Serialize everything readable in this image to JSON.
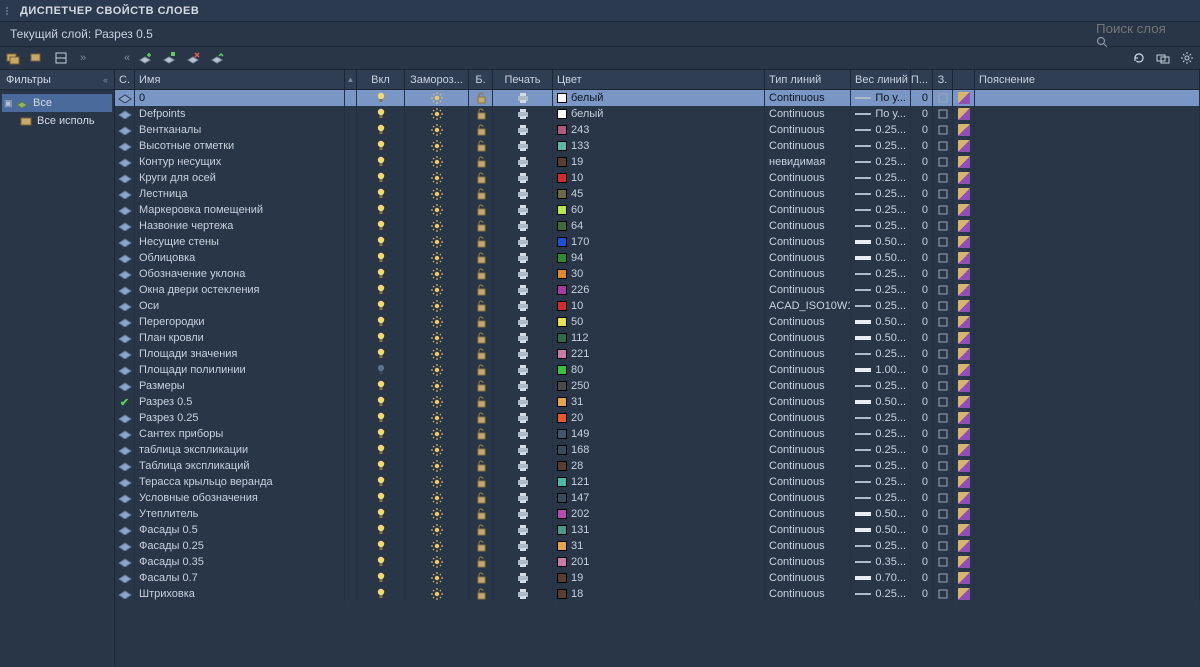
{
  "window": {
    "title": "ДИСПЕТЧЕР СВОЙСТВ СЛОЕВ"
  },
  "current_layer_label": "Текущий слой: Разрез 0.5",
  "search": {
    "placeholder": "Поиск слоя"
  },
  "sidebar": {
    "header": "Фильтры",
    "root": "Все",
    "used": "Все исполь"
  },
  "columns": {
    "status": "С.",
    "name": "Имя",
    "on": "Вкл",
    "freeze": "Замороз...",
    "lock": "Б.",
    "plot": "Печать",
    "color": "Цвет",
    "linetype": "Тип линий",
    "lineweight": "Вес линий",
    "transparency": "П...",
    "newvp_freeze": "З.",
    "description": "Пояснение"
  },
  "layers": [
    {
      "name": "0",
      "current": false,
      "selected": true,
      "on": true,
      "freeze": false,
      "locked": false,
      "plot": true,
      "color_name": "белый",
      "swatch": "#ffffff",
      "linetype": "Continuous",
      "lineweight": "По у...",
      "lw_heavy": false,
      "transparency": "0"
    },
    {
      "name": "Defpoints",
      "on": true,
      "color_name": "белый",
      "swatch": "#ffffff",
      "linetype": "Continuous",
      "lineweight": "По у...",
      "lw_heavy": false,
      "transparency": "0"
    },
    {
      "name": "Вентканалы",
      "on": true,
      "color_name": "243",
      "swatch": "#b05a7b",
      "linetype": "Continuous",
      "lineweight": "0.25...",
      "transparency": "0"
    },
    {
      "name": "Высотные отметки",
      "on": true,
      "color_name": "133",
      "swatch": "#5bb8a6",
      "linetype": "Continuous",
      "lineweight": "0.25...",
      "transparency": "0"
    },
    {
      "name": "Контур несущих",
      "on": true,
      "color_name": "19",
      "swatch": "#5a3d2e",
      "linetype": "невидимая",
      "lineweight": "0.25...",
      "transparency": "0"
    },
    {
      "name": "Круги для осей",
      "on": true,
      "color_name": "10",
      "swatch": "#d42a2a",
      "linetype": "Continuous",
      "lineweight": "0.25...",
      "transparency": "0"
    },
    {
      "name": "Лестница",
      "on": true,
      "color_name": "45",
      "swatch": "#6a6a45",
      "linetype": "Continuous",
      "lineweight": "0.25...",
      "transparency": "0"
    },
    {
      "name": "Маркеровка помещений",
      "on": true,
      "color_name": "60",
      "swatch": "#b6e84a",
      "linetype": "Continuous",
      "lineweight": "0.25...",
      "transparency": "0"
    },
    {
      "name": "Назвоние чертежа",
      "on": true,
      "color_name": "64",
      "swatch": "#3e6b3e",
      "linetype": "Continuous",
      "lineweight": "0.25...",
      "transparency": "0"
    },
    {
      "name": "Несущие стены",
      "on": true,
      "color_name": "170",
      "swatch": "#1a4fd6",
      "linetype": "Continuous",
      "lineweight": "0.50...",
      "lw_heavy": true,
      "transparency": "0"
    },
    {
      "name": "Облицовка",
      "on": true,
      "color_name": "94",
      "swatch": "#2e8b2e",
      "linetype": "Continuous",
      "lineweight": "0.50...",
      "lw_heavy": true,
      "transparency": "0"
    },
    {
      "name": "Обозначение уклона",
      "on": true,
      "color_name": "30",
      "swatch": "#e08a2a",
      "linetype": "Continuous",
      "lineweight": "0.25...",
      "transparency": "0"
    },
    {
      "name": "Окна двери остекления",
      "on": true,
      "color_name": "226",
      "swatch": "#a83aa8",
      "linetype": "Continuous",
      "lineweight": "0.25...",
      "transparency": "0"
    },
    {
      "name": "Оси",
      "on": true,
      "color_name": "10",
      "swatch": "#d42a2a",
      "linetype": "ACAD_ISO10W1...",
      "lineweight": "0.25...",
      "transparency": "0"
    },
    {
      "name": "Перегородки",
      "on": true,
      "color_name": "50",
      "swatch": "#e8e24a",
      "linetype": "Continuous",
      "lineweight": "0.50...",
      "lw_heavy": true,
      "transparency": "0"
    },
    {
      "name": "План кровли",
      "on": true,
      "color_name": "112",
      "swatch": "#2e6b4a",
      "linetype": "Continuous",
      "lineweight": "0.50...",
      "lw_heavy": true,
      "transparency": "0"
    },
    {
      "name": "Площади значения",
      "on": true,
      "color_name": "221",
      "swatch": "#c97aa6",
      "linetype": "Continuous",
      "lineweight": "0.25...",
      "transparency": "0"
    },
    {
      "name": "Площади полилинии",
      "on": false,
      "color_name": "80",
      "swatch": "#3ac23a",
      "linetype": "Continuous",
      "lineweight": "1.00...",
      "lw_heavy": true,
      "transparency": "0"
    },
    {
      "name": "Размеры",
      "on": true,
      "color_name": "250",
      "swatch": "#4a4a4a",
      "linetype": "Continuous",
      "lineweight": "0.25...",
      "transparency": "0"
    },
    {
      "name": "Разрез 0.5",
      "current": true,
      "on": true,
      "color_name": "31",
      "swatch": "#e8a24a",
      "linetype": "Continuous",
      "lineweight": "0.50...",
      "lw_heavy": true,
      "transparency": "0"
    },
    {
      "name": "Разрез 0.25",
      "on": true,
      "color_name": "20",
      "swatch": "#e85a2a",
      "linetype": "Continuous",
      "lineweight": "0.25...",
      "transparency": "0"
    },
    {
      "name": "Сантех приборы",
      "on": true,
      "color_name": "149",
      "swatch": "#42566b",
      "linetype": "Continuous",
      "lineweight": "0.25...",
      "transparency": "0"
    },
    {
      "name": "таблица экспликации",
      "on": true,
      "color_name": "168",
      "swatch": "#3a4a5a",
      "linetype": "Continuous",
      "lineweight": "0.25...",
      "transparency": "0"
    },
    {
      "name": "Таблица экспликаций",
      "on": true,
      "color_name": "28",
      "swatch": "#5a3d2e",
      "linetype": "Continuous",
      "lineweight": "0.25...",
      "transparency": "0"
    },
    {
      "name": "Терасса крыльцо веранда",
      "on": true,
      "color_name": "121",
      "swatch": "#4ab8a6",
      "linetype": "Continuous",
      "lineweight": "0.25...",
      "transparency": "0"
    },
    {
      "name": "Условные обозначения",
      "on": true,
      "color_name": "147",
      "swatch": "#3a4a5a",
      "linetype": "Continuous",
      "lineweight": "0.25...",
      "transparency": "0"
    },
    {
      "name": "Утеплитель",
      "on": true,
      "color_name": "202",
      "swatch": "#b84ab8",
      "linetype": "Continuous",
      "lineweight": "0.50...",
      "lw_heavy": true,
      "transparency": "0"
    },
    {
      "name": "Фасады 0.5",
      "on": true,
      "color_name": "131",
      "swatch": "#4a9a8a",
      "linetype": "Continuous",
      "lineweight": "0.50...",
      "lw_heavy": true,
      "transparency": "0"
    },
    {
      "name": "Фасады 0.25",
      "on": true,
      "color_name": "31",
      "swatch": "#e8a24a",
      "linetype": "Continuous",
      "lineweight": "0.25...",
      "transparency": "0"
    },
    {
      "name": "Фасады 0.35",
      "on": true,
      "color_name": "201",
      "swatch": "#c97aa6",
      "linetype": "Continuous",
      "lineweight": "0.35...",
      "transparency": "0"
    },
    {
      "name": "Фасалы 0.7",
      "on": true,
      "color_name": "19",
      "swatch": "#5a3d2e",
      "linetype": "Continuous",
      "lineweight": "0.70...",
      "lw_heavy": true,
      "transparency": "0"
    },
    {
      "name": "Штриховка",
      "on": true,
      "color_name": "18",
      "swatch": "#5a3d2e",
      "linetype": "Continuous",
      "lineweight": "0.25...",
      "transparency": "0"
    }
  ]
}
